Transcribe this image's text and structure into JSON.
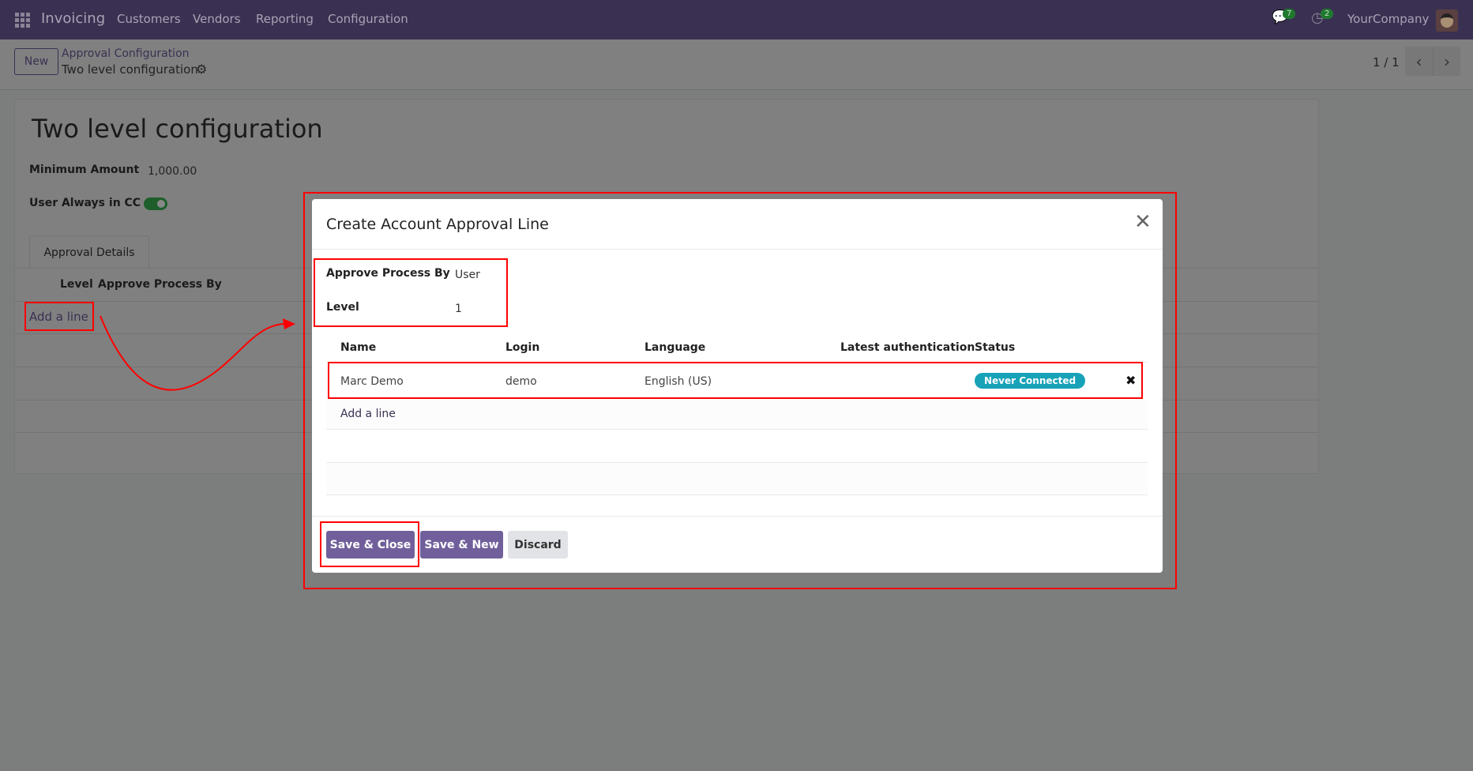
{
  "navbar": {
    "app": "Invoicing",
    "menus": [
      "Customers",
      "Vendors",
      "Reporting",
      "Configuration"
    ],
    "messages_count": "7",
    "activities_count": "2",
    "company": "YourCompany"
  },
  "control_panel": {
    "new_label": "New",
    "breadcrumb_parent": "Approval Configuration",
    "breadcrumb_current": "Two level configuration",
    "pager": "1 / 1"
  },
  "form": {
    "title": "Two level configuration",
    "min_amount_label": "Minimum Amount",
    "min_amount_value": "1,000.00",
    "cc_label": "User Always in CC",
    "cc_enabled": true,
    "tab": "Approval Details",
    "columns": [
      "Level",
      "Approve Process By"
    ],
    "add_line": "Add a line"
  },
  "modal": {
    "title": "Create Account Approval Line",
    "approve_by_label": "Approve Process By",
    "approve_by_value": "User",
    "level_label": "Level",
    "level_value": "1",
    "columns": [
      "Name",
      "Login",
      "Language",
      "Latest authentication",
      "Status"
    ],
    "rows": [
      {
        "name": "Marc Demo",
        "login": "demo",
        "language": "English (US)",
        "latest_auth": "",
        "status": "Never Connected"
      }
    ],
    "add_line": "Add a line",
    "save_close": "Save & Close",
    "save_new": "Save & New",
    "discard": "Discard"
  },
  "colors": {
    "primary": "#714B67",
    "status_badge": "#17a2b8",
    "annotation": "#ff0000"
  }
}
